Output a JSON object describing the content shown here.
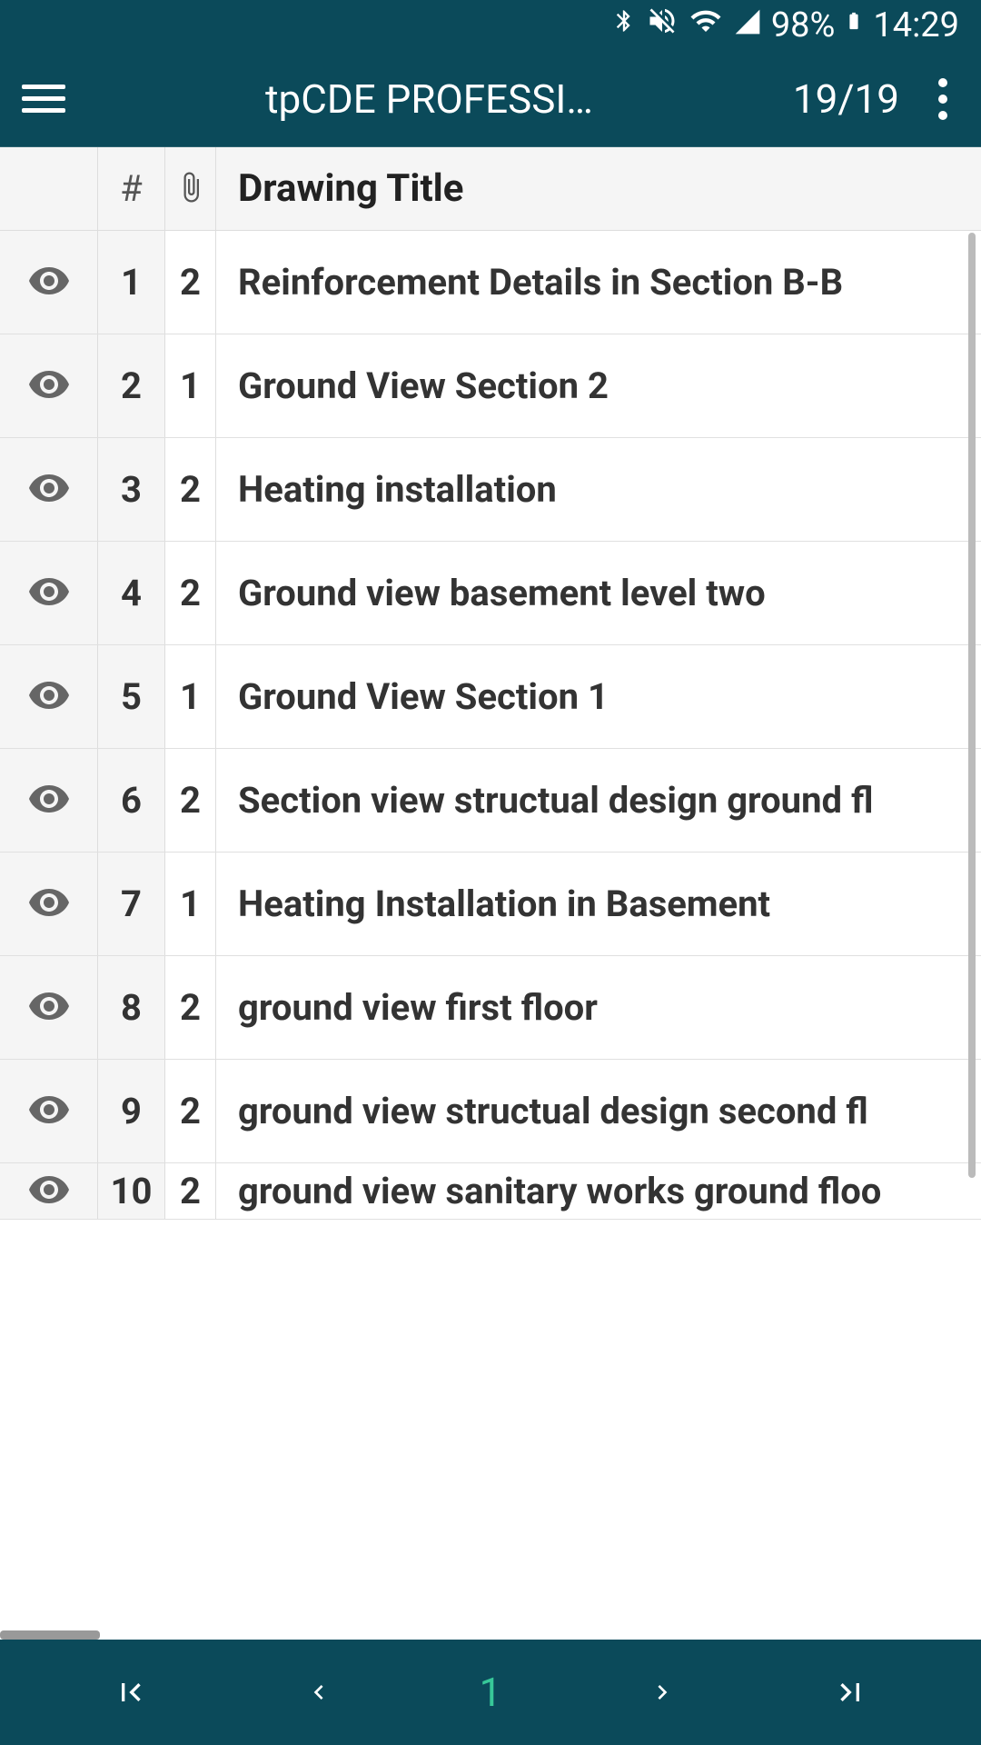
{
  "statusbar": {
    "battery_pct": "98%",
    "time": "14:29"
  },
  "appbar": {
    "title": "tpCDE PROFESSI…",
    "page_count": "19/19"
  },
  "table": {
    "headers": {
      "num": "#",
      "title": "Drawing Title"
    },
    "rows": [
      {
        "num": "1",
        "attach": "2",
        "title": "Reinforcement Details in Section B-B"
      },
      {
        "num": "2",
        "attach": "1",
        "title": "Ground View Section 2"
      },
      {
        "num": "3",
        "attach": "2",
        "title": "Heating installation"
      },
      {
        "num": "4",
        "attach": "2",
        "title": "Ground view basement level two"
      },
      {
        "num": "5",
        "attach": "1",
        "title": "Ground View Section 1"
      },
      {
        "num": "6",
        "attach": "2",
        "title": "Section view structual design ground fl"
      },
      {
        "num": "7",
        "attach": "1",
        "title": "Heating Installation in Basement"
      },
      {
        "num": "8",
        "attach": "2",
        "title": "ground view first floor"
      },
      {
        "num": "9",
        "attach": "2",
        "title": "ground view structual design second fl"
      },
      {
        "num": "10",
        "attach": "2",
        "title": "ground view sanitary works ground floo"
      }
    ]
  },
  "bottomnav": {
    "current_page": "1"
  }
}
